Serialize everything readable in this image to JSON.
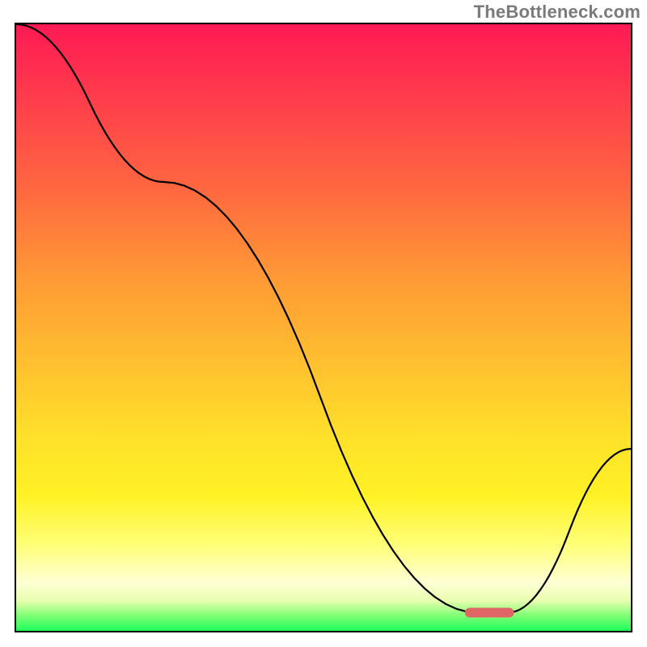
{
  "attribution": "TheBottleneck.com",
  "colors": {
    "gradient_top": "#ff1a54",
    "gradient_mid1": "#ff9a35",
    "gradient_mid2": "#ffe02a",
    "gradient_low": "#ffffd5",
    "gradient_bottom": "#1dff5b",
    "line": "#000000",
    "marker": "#e06666",
    "frame": "#000000",
    "attribution_text": "#7a7a7a"
  },
  "chart_data": {
    "type": "line",
    "title": "",
    "xlabel": "",
    "ylabel": "",
    "xlim": [
      0,
      100
    ],
    "ylim": [
      0,
      100
    ],
    "x": [
      0,
      24,
      75,
      80,
      100
    ],
    "values": [
      100,
      74,
      3,
      3,
      30
    ],
    "marker": {
      "x_start": 73,
      "x_end": 81,
      "y": 3
    },
    "annotations": []
  }
}
